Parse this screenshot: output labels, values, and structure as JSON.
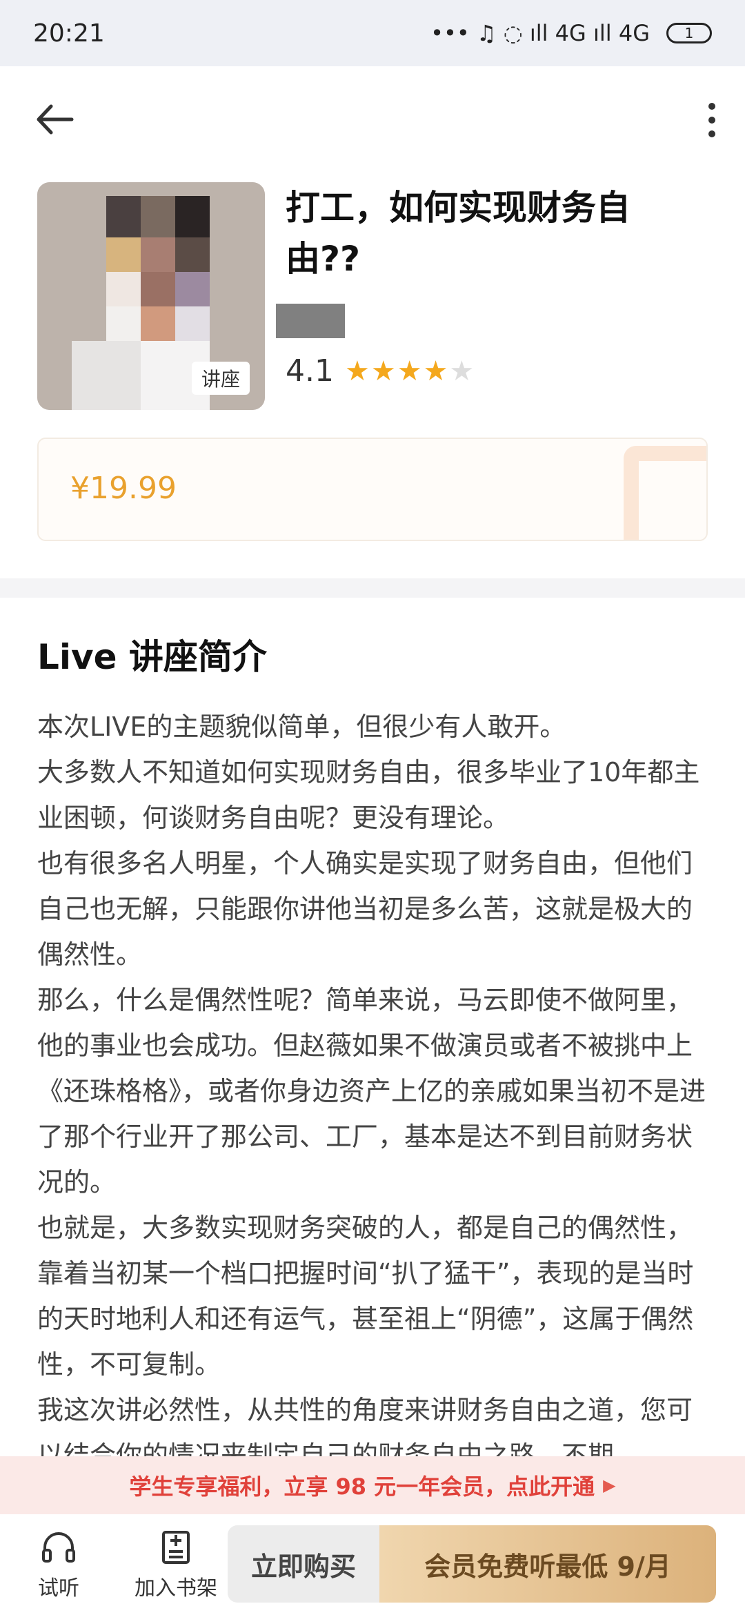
{
  "status_bar": {
    "time": "20:21",
    "indicators": "••• ♫ ◌ ıll 4G ıll 4G",
    "battery": "1"
  },
  "course": {
    "cover_badge": "讲座",
    "title": "打工，如何实现财务自由??",
    "rating": "4.1",
    "stars_filled": 4,
    "stars_total": 5,
    "price": "¥19.99"
  },
  "intro": {
    "heading": "Live 讲座简介",
    "paragraphs": [
      "本次LIVE的主题貌似简单，但很少有人敢开。",
      "大多数人不知道如何实现财务自由，很多毕业了10年都主业困顿，何谈财务自由呢？更没有理论。",
      "也有很多名人明星，个人确实是实现了财务自由，但他们自己也无解，只能跟你讲他当初是多么苦，这就是极大的偶然性。",
      "那么，什么是偶然性呢？简单来说，马云即使不做阿里，他的事业也会成功。但赵薇如果不做演员或者不被挑中上《还珠格格》，或者你身边资产上亿的亲戚如果当初不是进了那个行业开了那公司、工厂，基本是达不到目前财务状况的。",
      "也就是，大多数实现财务突破的人，都是自己的偶然性，靠着当初某一个档口把握时间“扒了猛干”，表现的是当时的天时地利人和还有运气，甚至祖上“阴德”，这属于偶然性，不可复制。",
      "我这次讲必然性，从共性的角度来讲财务自由之道，您可以结合你的情况来制定自己的财务自由之路，不期"
    ]
  },
  "promo": {
    "text": "学生专享福利，立享 98 元一年会员，点此开通"
  },
  "bottom_bar": {
    "listen_label": "试听",
    "bookshelf_label": "加入书架",
    "buy_label": "立即购买",
    "vip_label": "会员免费听最低 9/月"
  },
  "colors": {
    "price": "#e9a12e",
    "star": "#f4a81d",
    "promo_text": "#e0413a",
    "vip_gradient_start": "#f0d6ae",
    "vip_gradient_end": "#dcb27b"
  }
}
